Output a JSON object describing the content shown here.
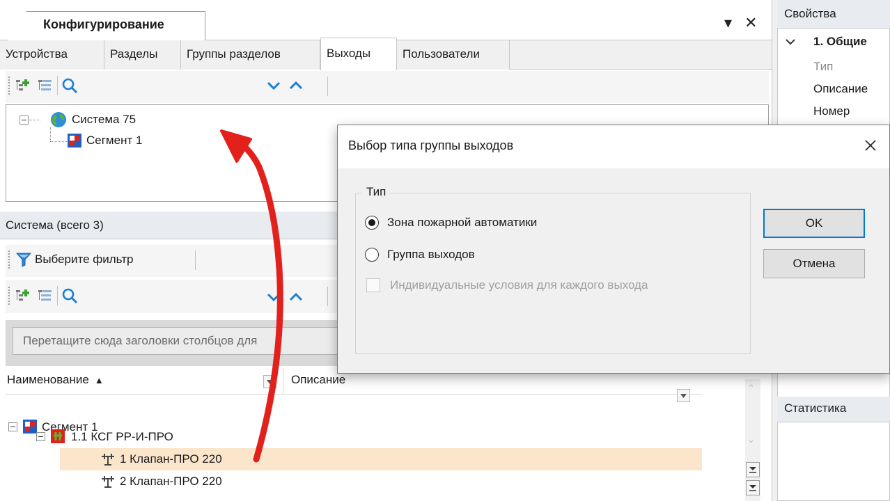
{
  "doc_tab": {
    "title": "Конфигурирование",
    "controls": "▾ ✕"
  },
  "sub_tabs": [
    "Устройства",
    "Разделы",
    "Группы разделов",
    "Выходы",
    "Пользователи"
  ],
  "tree": [
    {
      "label": "Система 75"
    },
    {
      "label": "Сегмент 1"
    }
  ],
  "system_panel": {
    "title": "Система (всего 3)",
    "filter_label": "Выберите фильтр"
  },
  "grid": {
    "group_hint": "Перетащите сюда заголовки столбцов для",
    "columns": [
      "Наименование",
      "Описание"
    ],
    "sort_indicator": "▲",
    "rows": [
      {
        "label": "Сегмент 1"
      },
      {
        "label": "1.1 КСГ РР-И-ПРО"
      },
      {
        "label": "1 Клапан-ПРО 220"
      },
      {
        "label": "2 Клапан-ПРО 220"
      }
    ]
  },
  "props": {
    "title": "Свойства",
    "section": "1. Общие",
    "fields": [
      "Тип",
      "Описание",
      "Номер"
    ],
    "stats_title": "Статистика"
  },
  "dialog": {
    "title": "Выбор типа группы выходов",
    "group_label": "Тип",
    "options": [
      {
        "label": "Зона пожарной автоматики",
        "selected": true
      },
      {
        "label": "Группа выходов",
        "selected": false
      }
    ],
    "checkbox_label": "Индивидуальные условия для каждого выхода",
    "ok_label": "OK",
    "cancel_label": "Отмена"
  },
  "colors": {
    "accent": "#0078d7",
    "arrow": "#e3211c",
    "selection": "#fbe6cc",
    "disabled_text": "#a0a0a0"
  }
}
